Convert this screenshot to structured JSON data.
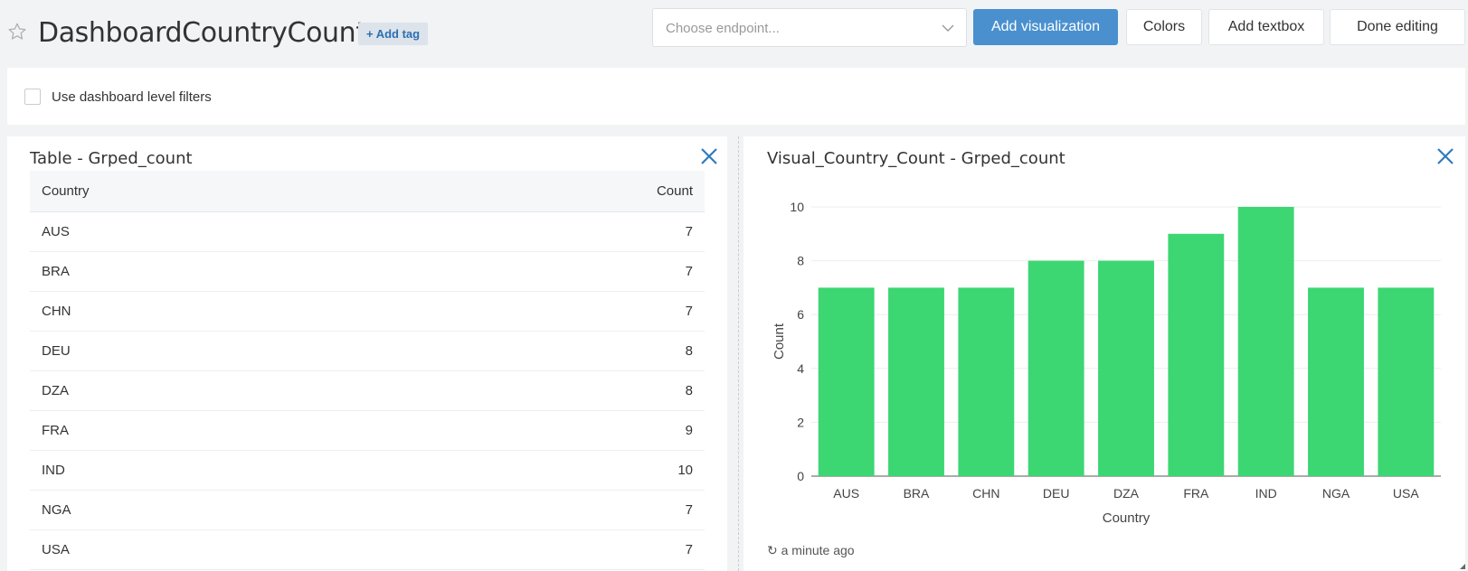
{
  "header": {
    "title": "DashboardCountryCount",
    "add_tag": "+ Add tag",
    "endpoint_placeholder": "Choose endpoint...",
    "buttons": {
      "add_visualization": "Add visualization",
      "colors": "Colors",
      "add_textbox": "Add textbox",
      "done_editing": "Done editing"
    }
  },
  "filters": {
    "use_dashboard_filters_label": "Use dashboard level filters",
    "checked": false
  },
  "table_widget": {
    "title": "Table - Grped_count",
    "columns": [
      "Country",
      "Count"
    ],
    "rows": [
      [
        "AUS",
        "7"
      ],
      [
        "BRA",
        "7"
      ],
      [
        "CHN",
        "7"
      ],
      [
        "DEU",
        "8"
      ],
      [
        "DZA",
        "8"
      ],
      [
        "FRA",
        "9"
      ],
      [
        "IND",
        "10"
      ],
      [
        "NGA",
        "7"
      ],
      [
        "USA",
        "7"
      ]
    ]
  },
  "chart_widget": {
    "title": "Visual_Country_Count - Grped_count",
    "refresh_text": "a minute ago"
  },
  "chart_data": {
    "type": "bar",
    "categories": [
      "AUS",
      "BRA",
      "CHN",
      "DEU",
      "DZA",
      "FRA",
      "IND",
      "NGA",
      "USA"
    ],
    "values": [
      7,
      7,
      7,
      8,
      8,
      9,
      10,
      7,
      7
    ],
    "xlabel": "Country",
    "ylabel": "Count",
    "ylim": [
      0,
      10
    ],
    "yticks": [
      0,
      2,
      4,
      6,
      8,
      10
    ],
    "grid": true,
    "bar_color": "#3cd673"
  },
  "colors": {
    "accent": "#4a90cf",
    "close_icon": "#2f7bbf",
    "tag_text": "#2a6fb3"
  }
}
